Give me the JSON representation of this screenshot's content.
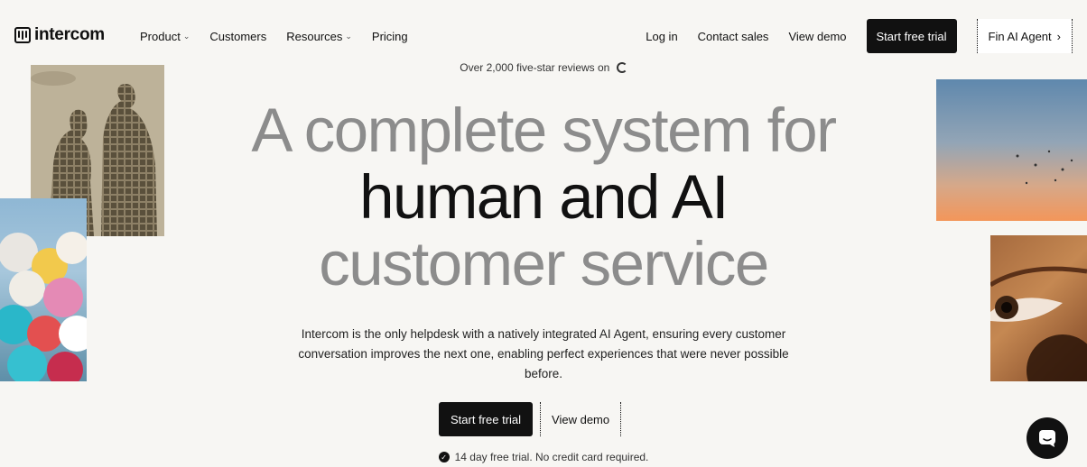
{
  "nav": {
    "logo_text": "intercom",
    "left_items": [
      {
        "label": "Product",
        "has_menu": true
      },
      {
        "label": "Customers",
        "has_menu": false
      },
      {
        "label": "Resources",
        "has_menu": true
      },
      {
        "label": "Pricing",
        "has_menu": false
      }
    ],
    "login": "Log in",
    "contact_sales": "Contact sales",
    "view_demo": "View demo",
    "start_trial": "Start free trial",
    "fin_agent": "Fin AI Agent",
    "fin_agent_arrow": "›"
  },
  "hero": {
    "reviews": "Over 2,000 five-star reviews on",
    "headline_line1": "A complete system for",
    "headline_line2": "human and AI",
    "headline_line3": "customer service",
    "subtitle": "Intercom is the only helpdesk with a natively integrated AI Agent, ensuring every customer conversation improves the next one, enabling perfect experiences that were never possible before.",
    "cta_primary": "Start free trial",
    "cta_secondary": "View demo",
    "note": "14 day free trial. No credit card required."
  },
  "colors": {
    "background": "#f7f6f3",
    "headline_grey": "#8c8c8c",
    "button_dark": "#111111"
  },
  "icons": [
    "chevron-down-icon",
    "google-icon",
    "check-circle-icon",
    "chat-icon"
  ]
}
